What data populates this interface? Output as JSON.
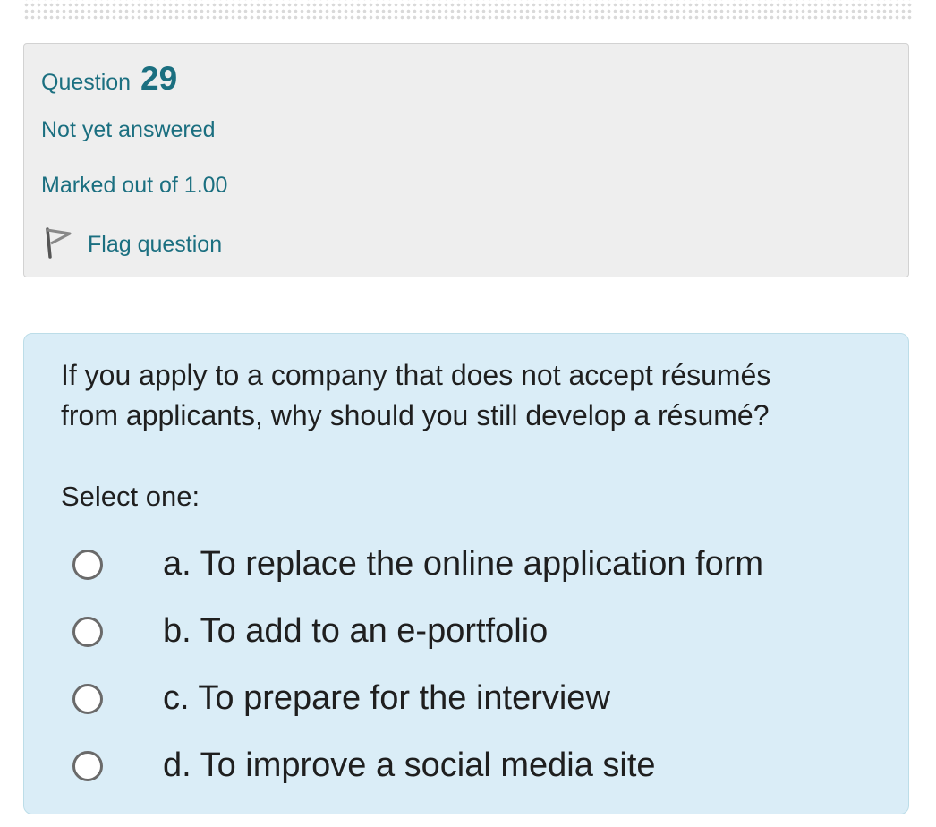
{
  "question_info": {
    "question_label": "Question",
    "question_number": "29",
    "state": "Not yet answered",
    "grade": "Marked out of 1.00",
    "flag_label": "Flag question",
    "flag_icon": "flag-outline-icon"
  },
  "question": {
    "text": "If you apply to a company that does not accept résumés from applicants, why should you still develop a résumé?",
    "prompt": "Select one:",
    "options": [
      {
        "label": "a. To replace the online application form",
        "selected": false
      },
      {
        "label": "b. To add to an e-portfolio",
        "selected": false
      },
      {
        "label": "c. To prepare for the interview",
        "selected": false
      },
      {
        "label": "d. To improve a social media site",
        "selected": false
      }
    ]
  },
  "colors": {
    "info_background": "#eeeeee",
    "info_text": "#1b6f80",
    "content_background": "#daedf7",
    "content_border": "#bcdde8",
    "body_text": "#1f1f1f",
    "radio_border": "#6a6a6a"
  }
}
